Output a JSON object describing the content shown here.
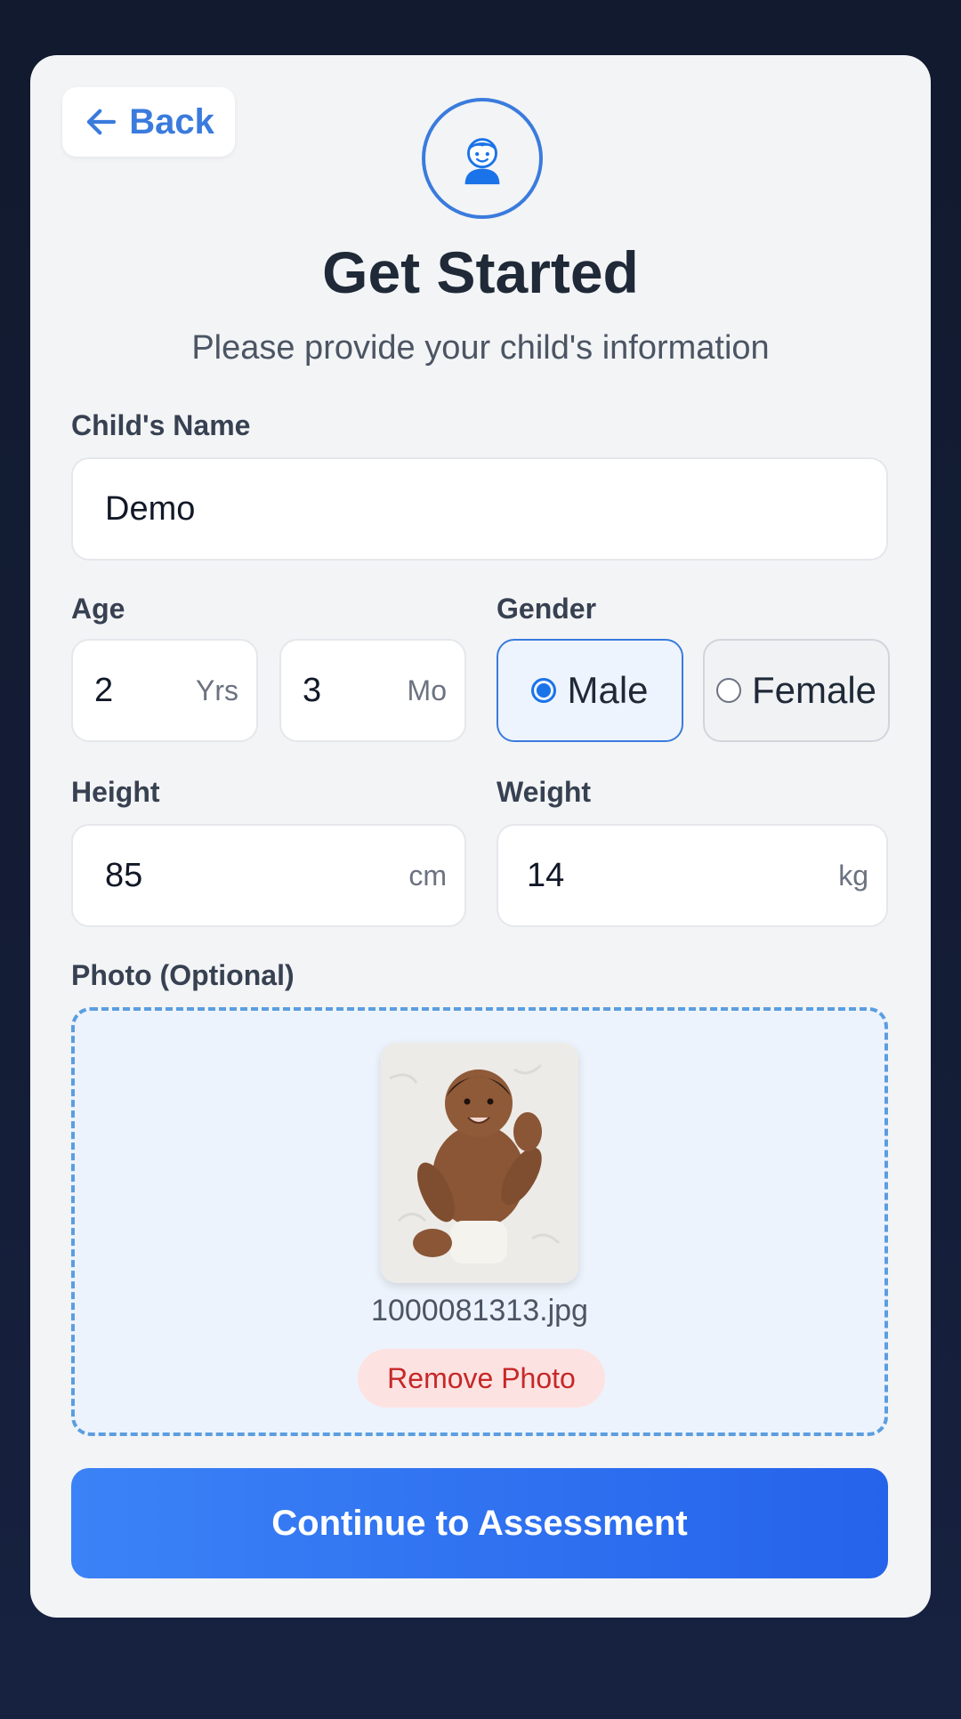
{
  "nav": {
    "back_label": "Back",
    "back_icon": "arrow-left-icon"
  },
  "header": {
    "avatar_icon": "child-avatar-icon",
    "title": "Get Started",
    "subtitle": "Please provide your child's information"
  },
  "form": {
    "name": {
      "label": "Child's Name",
      "value": "Demo"
    },
    "age": {
      "label": "Age",
      "years_value": "2",
      "years_unit": "Yrs",
      "months_value": "3",
      "months_unit": "Mo"
    },
    "gender": {
      "label": "Gender",
      "options": [
        {
          "label": "Male",
          "selected": true
        },
        {
          "label": "Female",
          "selected": false
        }
      ]
    },
    "height": {
      "label": "Height",
      "value": "85",
      "unit": "cm"
    },
    "weight": {
      "label": "Weight",
      "value": "14",
      "unit": "kg"
    },
    "photo": {
      "label": "Photo (Optional)",
      "file_name": "1000081313.jpg",
      "remove_label": "Remove Photo"
    }
  },
  "actions": {
    "continue_label": "Continue to Assessment"
  },
  "colors": {
    "accent": "#3a7bdd",
    "primary_button": "#2563eb",
    "danger_text": "#c62828",
    "danger_bg": "#fde2e2",
    "background": "#111a2e",
    "card": "#f3f4f6"
  }
}
